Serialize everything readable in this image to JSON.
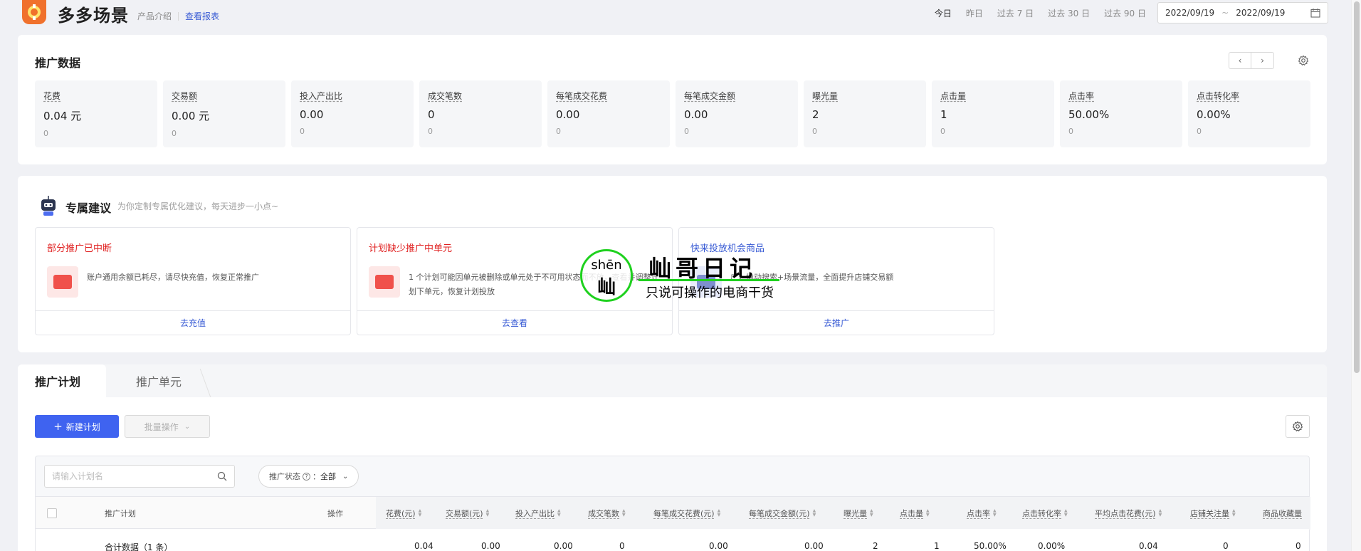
{
  "header": {
    "app_title": "多多场景",
    "product_intro": "产品介绍",
    "view_report": "查看报表",
    "date_presets": [
      "今日",
      "昨日",
      "过去 7 日",
      "过去 30 日",
      "过去 90 日"
    ],
    "date_start": "2022/09/19",
    "date_sep": "~",
    "date_end": "2022/09/19"
  },
  "promo_data": {
    "title": "推广数据",
    "metrics": [
      {
        "label": "花费",
        "value": "0.04 元",
        "compare": "0"
      },
      {
        "label": "交易额",
        "value": "0.00 元",
        "compare": "0"
      },
      {
        "label": "投入产出比",
        "value": "0.00",
        "compare": "0"
      },
      {
        "label": "成交笔数",
        "value": "0",
        "compare": "0"
      },
      {
        "label": "每笔成交花费",
        "value": "0.00",
        "compare": "0"
      },
      {
        "label": "每笔成交金额",
        "value": "0.00",
        "compare": "0"
      },
      {
        "label": "曝光量",
        "value": "2",
        "compare": "0"
      },
      {
        "label": "点击量",
        "value": "1",
        "compare": "0"
      },
      {
        "label": "点击率",
        "value": "50.00%",
        "compare": "0"
      },
      {
        "label": "点击转化率",
        "value": "0.00%",
        "compare": "0"
      }
    ]
  },
  "suggestions": {
    "title": "专属建议",
    "subtitle": "为你定制专属优化建议，每天进步一小点~",
    "items": [
      {
        "title": "部分推广已中断",
        "desc": "账户通用余额已耗尽，请尽快充值，恢复正常推广",
        "action": "去充值",
        "color": "#e02020"
      },
      {
        "title": "计划缺少推广中单元",
        "desc": "1 个计划可能因单元被删除或单元处于不可用状态而不放，查看并调整计划下单元，恢复计划投放",
        "action": "去查看",
        "color": "#e02020"
      },
      {
        "title": "快来投放机会商品",
        "desc": "广，撬动搜索+场景流量，全面提升店铺交易额",
        "action": "去推广",
        "color": "#3659d4"
      }
    ]
  },
  "watermark": {
    "pinyin": "shēn",
    "char": "屾",
    "brand": "屾哥日记",
    "slogan": "只说可操作的电商干货"
  },
  "plans": {
    "tabs": [
      "推广计划",
      "推广单元"
    ],
    "new_button": "新建计划",
    "batch_button": "批量操作",
    "search_placeholder": "请输入计划名",
    "filter_label": "推广状态",
    "filter_value": "全部",
    "columns": [
      "推广计划",
      "操作",
      "花费(元)",
      "交易额(元)",
      "投入产出比",
      "成交笔数",
      "每笔成交花费(元)",
      "每笔成交金额(元)",
      "曝光量",
      "点击量",
      "点击率",
      "点击转化率",
      "平均点击花费(元)",
      "店铺关注量",
      "商品收藏量"
    ],
    "summary_row": [
      "合计数据（1 条）",
      "0.04",
      "0.00",
      "0.00",
      "0",
      "0.00",
      "0.00",
      "2",
      "1",
      "50.00%",
      "0.00%",
      "0.04",
      "0",
      "0"
    ]
  },
  "colors": {
    "primary": "#3f63f0",
    "link": "#3659d4",
    "warning": "#e02020",
    "logo": "#f0712c"
  }
}
